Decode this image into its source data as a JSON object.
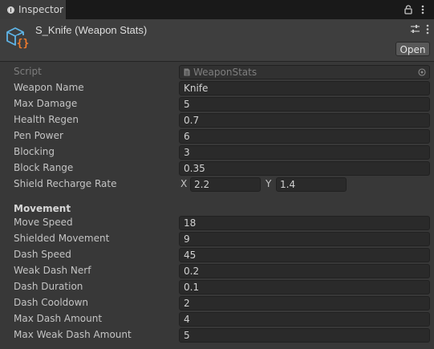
{
  "tab": {
    "title": "Inspector"
  },
  "header": {
    "title": "S_Knife (Weapon Stats)",
    "open_label": "Open"
  },
  "script": {
    "label": "Script",
    "value": "WeaponStats"
  },
  "fields": [
    {
      "label": "Weapon Name",
      "value": "Knife"
    },
    {
      "label": "Max Damage",
      "value": "5"
    },
    {
      "label": "Health Regen",
      "value": "0.7"
    },
    {
      "label": "Pen Power",
      "value": "6"
    },
    {
      "label": "Blocking",
      "value": "3"
    },
    {
      "label": "Block Range",
      "value": "0.35"
    }
  ],
  "shield": {
    "label": "Shield Recharge Rate",
    "x_label": "X",
    "x": "2.2",
    "y_label": "Y",
    "y": "1.4"
  },
  "movement": {
    "title": "Movement",
    "fields": [
      {
        "label": "Move Speed",
        "value": "18"
      },
      {
        "label": "Shielded Movement",
        "value": "9"
      },
      {
        "label": "Dash Speed",
        "value": "45"
      },
      {
        "label": "Weak Dash Nerf",
        "value": "0.2"
      },
      {
        "label": "Dash Duration",
        "value": "0.1"
      },
      {
        "label": "Dash Cooldown",
        "value": "2"
      },
      {
        "label": "Max Dash Amount",
        "value": "4"
      },
      {
        "label": "Max Weak Dash Amount",
        "value": "5"
      }
    ]
  }
}
